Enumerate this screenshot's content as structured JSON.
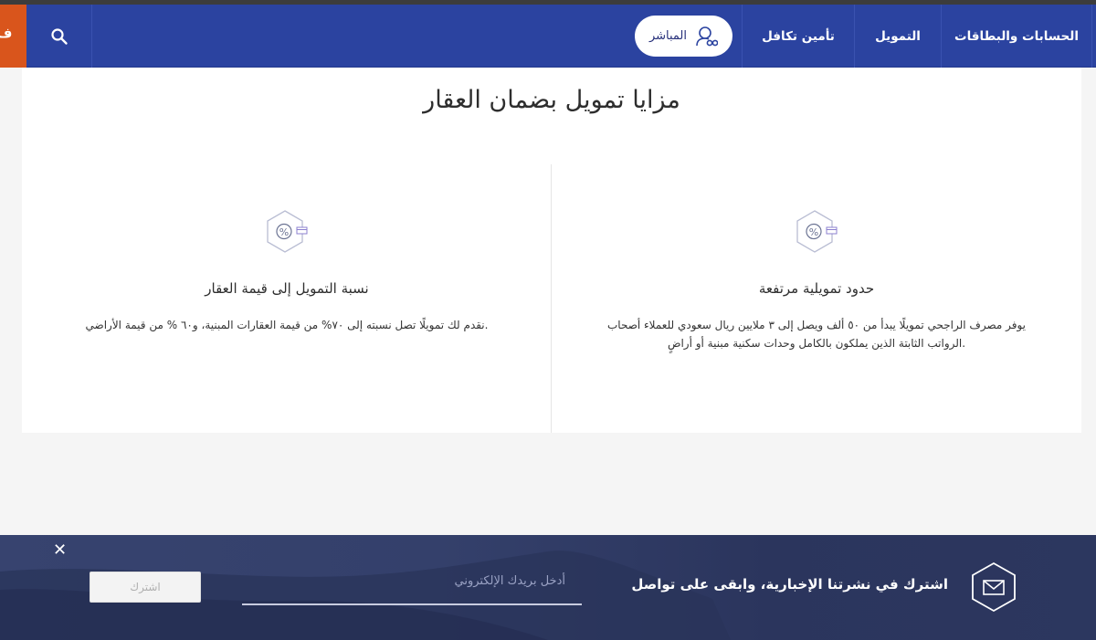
{
  "nav": {
    "items": [
      {
        "label": "الحسابات والبطاقات"
      },
      {
        "label": "التمويل"
      },
      {
        "label": "تأمين تكافل"
      }
    ],
    "live_label": "المباشر",
    "orange_tab_char": "ف",
    "colors": {
      "bar": "#2b43a0",
      "accent": "#d9551c"
    }
  },
  "section": {
    "title": "مزايا تمويل بضمان العقار",
    "features": [
      {
        "icon": "percent-card-icon",
        "title": "حدود تمويلية مرتفعة",
        "text_line1": "يوفر مصرف الراجحي تمويلًا يبدأ من ٥٠ ألف ويصل إلى ٣ ملايين ريال سعودي للعملاء أصحاب",
        "text_line2": "الرواتب الثابتة الذين يملكون بالكامل وحدات سكنية مبنية أو أراضٍ."
      },
      {
        "icon": "percent-card-icon",
        "title": "نسبة التمويل إلى قيمة العقار",
        "text_line1": "نقدم لك تمويلًا تصل نسبته إلى ٧٠% من قيمة العقارات المبنية، و٦٠ % من قيمة الأراضي."
      }
    ]
  },
  "newsletter": {
    "text": "اشترك في نشرتنا الإخبارية، وابقى على تواصل",
    "email_placeholder": "أدخل بريدك الإلكتروني",
    "subscribe_label": "اشترك",
    "close_glyph": "✕"
  }
}
